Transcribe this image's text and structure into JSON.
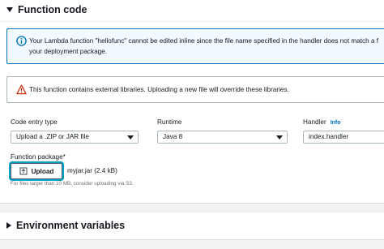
{
  "function_code": {
    "title": "Function code",
    "info_alert": {
      "icon": "info-circle-icon",
      "line1": "Your Lambda function \"hellofunc\" cannot be edited inline since the file name specified in the handler does not match a f",
      "line2": "your deployment package."
    },
    "warning_alert": {
      "icon": "warning-triangle-icon",
      "text": "This function contains external libraries. Uploading a new file will override these libraries."
    },
    "code_entry_type": {
      "label": "Code entry type",
      "value": "Upload a .ZIP or JAR file"
    },
    "runtime": {
      "label": "Runtime",
      "value": "Java 8"
    },
    "handler": {
      "label": "Handler",
      "info": "Info",
      "value": "index.handler"
    },
    "function_package": {
      "label": "Function package*",
      "upload_label": "Upload",
      "file": "myjar.jar (2.4 kB)",
      "hint": "For files larger than 10 MB, consider uploading via S3."
    }
  },
  "environment_variables": {
    "title": "Environment variables"
  },
  "colors": {
    "info_border": "#0073bb",
    "info_bg": "#f1faff",
    "warning_red": "#d13212",
    "focus_ring": "#00a1c9"
  }
}
